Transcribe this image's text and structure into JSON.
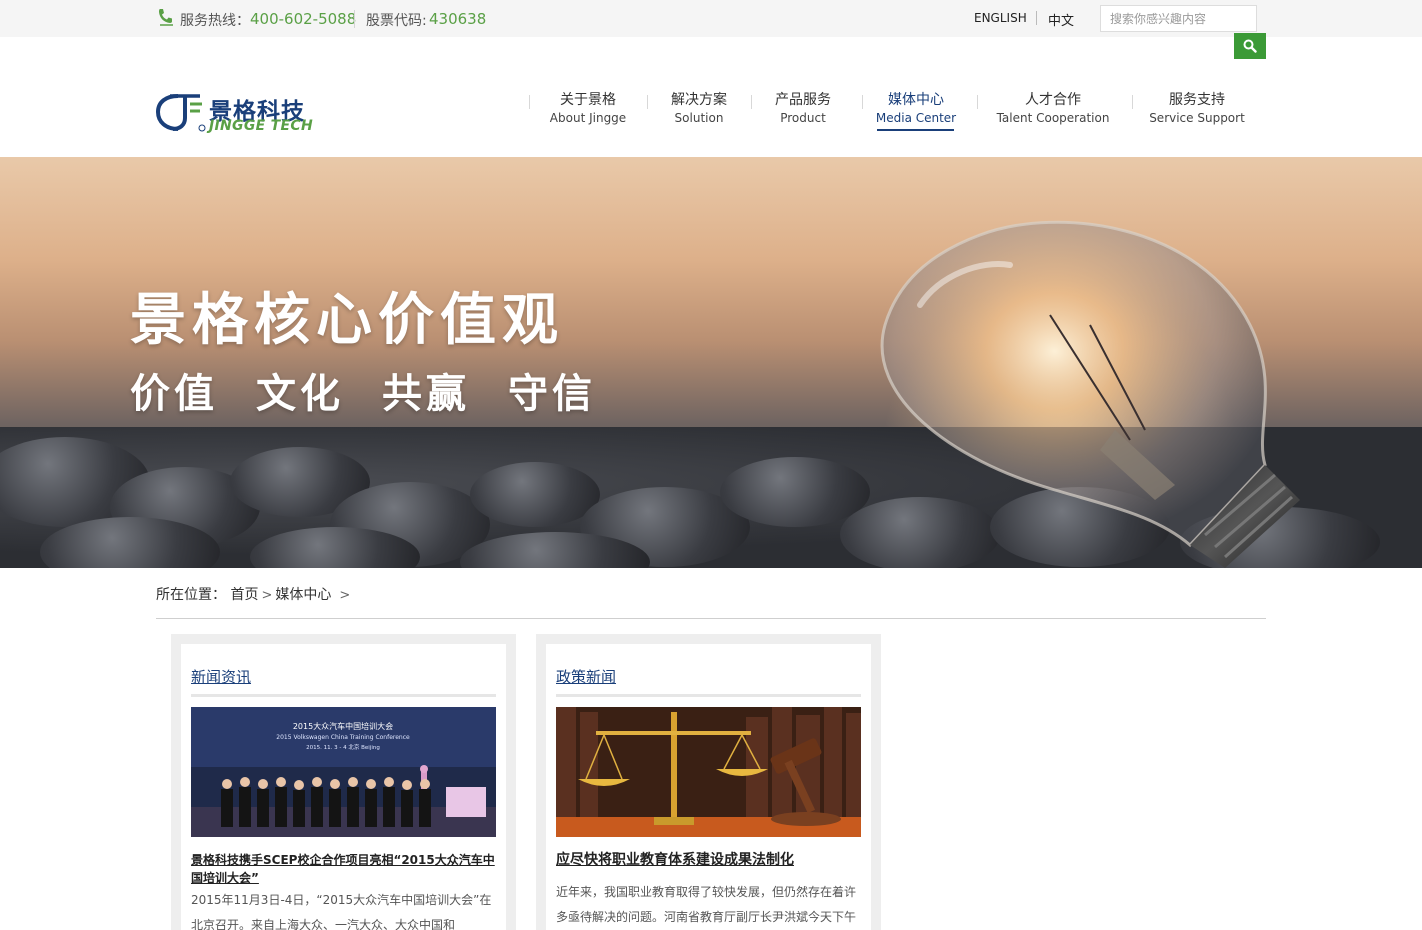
{
  "topbar": {
    "hotline_label": "服务热线：",
    "hotline_value": "400-602-5088",
    "stock_label": "股票代码:",
    "stock_value": "430638",
    "lang_en": "ENGLISH",
    "lang_zh": "中文",
    "search_placeholder": "搜索你感兴趣内容",
    "phone_icon": "phone-icon",
    "search_icon": "magnifier-icon"
  },
  "logo": {
    "cn": "景格科技",
    "en": "JINGGE TECH"
  },
  "nav": {
    "items": [
      {
        "cn": "关于景格",
        "en": "About Jingge"
      },
      {
        "cn": "解决方案",
        "en": "Solution"
      },
      {
        "cn": "产品服务",
        "en": "Product"
      },
      {
        "cn": "媒体中心",
        "en": "Media Center"
      },
      {
        "cn": "人才合作",
        "en": "Talent Cooperation"
      },
      {
        "cn": "服务支持",
        "en": "Service Support"
      }
    ],
    "active_index": 3
  },
  "banner": {
    "title": "景格核心价值观",
    "values": [
      "价值",
      "文化",
      "共赢",
      "守信"
    ]
  },
  "breadcrumb": {
    "label": "所在位置：",
    "home": "首页",
    "current": "媒体中心",
    "arrow": ">"
  },
  "cards": [
    {
      "title": "新闻资讯",
      "image_text_line1": "2015大众汽车中国培训大会",
      "image_text_line2": "2015 Volkswagen China Training Conference",
      "image_text_line3": "2015. 11. 3 - 4  北京  Beijing",
      "headline": "景格科技携手SCEP校企合作项目亮相“2015大众汽车中国培训大会”",
      "body": "2015年11月3日-4日，“2015大众汽车中国培训大会”在北京召开。来自上海大众、一汽大众、大众中国和"
    },
    {
      "title": "政策新闻",
      "headline": "应尽快将职业教育体系建设成果法制化",
      "body": "近年来，我国职业教育取得了较快发展，但仍然存在着许多亟待解决的问题。河南省教育厅副厅长尹洪斌今天下午在小组讨论时表示，按下去应该强化提升职业教育地位"
    }
  ],
  "colors": {
    "brand_blue": "#1a3f7a",
    "brand_green": "#5aa046",
    "search_green": "#3b9a36"
  }
}
